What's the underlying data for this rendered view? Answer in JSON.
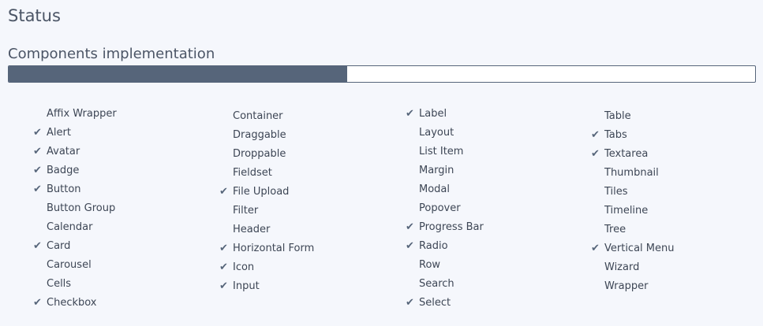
{
  "page": {
    "title": "Status",
    "section_title": "Components implementation"
  },
  "progress": {
    "fraction": 0.453
  },
  "check_icon": "✔",
  "columns": [
    [
      {
        "label": "Affix Wrapper",
        "done": false
      },
      {
        "label": "Alert",
        "done": true
      },
      {
        "label": "Avatar",
        "done": true
      },
      {
        "label": "Badge",
        "done": true
      },
      {
        "label": "Button",
        "done": true
      },
      {
        "label": "Button Group",
        "done": false
      },
      {
        "label": "Calendar",
        "done": false
      },
      {
        "label": "Card",
        "done": true
      },
      {
        "label": "Carousel",
        "done": false
      },
      {
        "label": "Cells",
        "done": false
      },
      {
        "label": "Checkbox",
        "done": true
      }
    ],
    [
      {
        "label": "Container",
        "done": false
      },
      {
        "label": "Draggable",
        "done": false
      },
      {
        "label": "Droppable",
        "done": false
      },
      {
        "label": "Fieldset",
        "done": false
      },
      {
        "label": "File Upload",
        "done": true
      },
      {
        "label": "Filter",
        "done": false
      },
      {
        "label": "Header",
        "done": false
      },
      {
        "label": "Horizontal Form",
        "done": true
      },
      {
        "label": "Icon",
        "done": true
      },
      {
        "label": "Input",
        "done": true
      }
    ],
    [
      {
        "label": "Label",
        "done": true
      },
      {
        "label": "Layout",
        "done": false
      },
      {
        "label": "List Item",
        "done": false
      },
      {
        "label": "Margin",
        "done": false
      },
      {
        "label": "Modal",
        "done": false
      },
      {
        "label": "Popover",
        "done": false
      },
      {
        "label": "Progress Bar",
        "done": true
      },
      {
        "label": "Radio",
        "done": true
      },
      {
        "label": "Row",
        "done": false
      },
      {
        "label": "Search",
        "done": false
      },
      {
        "label": "Select",
        "done": true
      }
    ],
    [
      {
        "label": "Table",
        "done": false
      },
      {
        "label": "Tabs",
        "done": true
      },
      {
        "label": "Textarea",
        "done": true
      },
      {
        "label": "Thumbnail",
        "done": false
      },
      {
        "label": "Tiles",
        "done": false
      },
      {
        "label": "Timeline",
        "done": false
      },
      {
        "label": "Tree",
        "done": false
      },
      {
        "label": "Vertical Menu",
        "done": true
      },
      {
        "label": "Wizard",
        "done": false
      },
      {
        "label": "Wrapper",
        "done": false
      }
    ]
  ]
}
